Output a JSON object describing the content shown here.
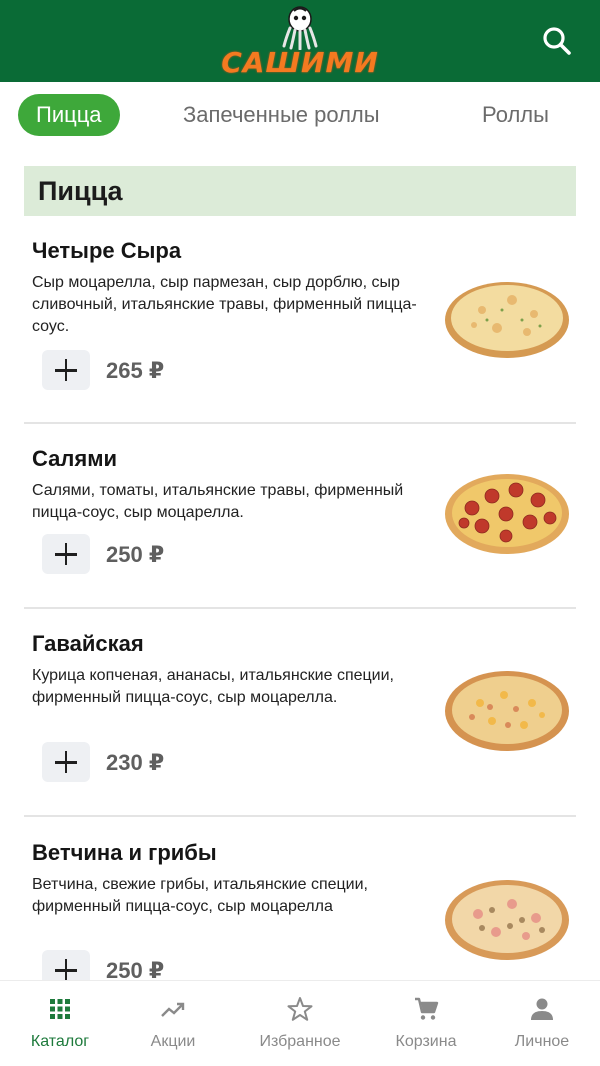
{
  "brand": {
    "logo_text": "САШИМИ",
    "header_color": "#0a6b36",
    "logo_color": "#f47a20"
  },
  "tabs": [
    {
      "label": "Пицца",
      "active": true
    },
    {
      "label": "Запеченные роллы",
      "active": false
    },
    {
      "label": "Роллы",
      "active": false
    }
  ],
  "section": {
    "title": "Пицца"
  },
  "products": [
    {
      "name": "Четыре Сыра",
      "description": "Сыр моцарелла, сыр пармезан, сыр дорблю, сыр сливочный, итальянские травы, фирменный пицца-соус.",
      "price": "265 ₽"
    },
    {
      "name": "Салями",
      "description": "Салями, томаты, итальянские травы, фирменный пицца-соус, сыр моцарелла.",
      "price": "250 ₽"
    },
    {
      "name": "Гавайская",
      "description": "Курица копченая, ананасы, итальянские специи, фирменный пицца-соус, сыр моцарелла.",
      "price": "230 ₽"
    },
    {
      "name": "Ветчина и грибы",
      "description": "Ветчина, свежие грибы, итальянские специи, фирменный пицца-соус, сыр моцарелла",
      "price": "250 ₽"
    }
  ],
  "nav": [
    {
      "label": "Каталог",
      "icon": "grid-icon",
      "active": true
    },
    {
      "label": "Акции",
      "icon": "trending-up-icon",
      "active": false
    },
    {
      "label": "Избранное",
      "icon": "star-icon",
      "active": false
    },
    {
      "label": "Корзина",
      "icon": "cart-icon",
      "active": false
    },
    {
      "label": "Личное",
      "icon": "person-icon",
      "active": false
    }
  ],
  "colors": {
    "accent": "#3ea83a",
    "section_bg": "#dcebd8",
    "nav_active": "#1e7a3c",
    "nav_inactive": "#8a8a8a"
  }
}
